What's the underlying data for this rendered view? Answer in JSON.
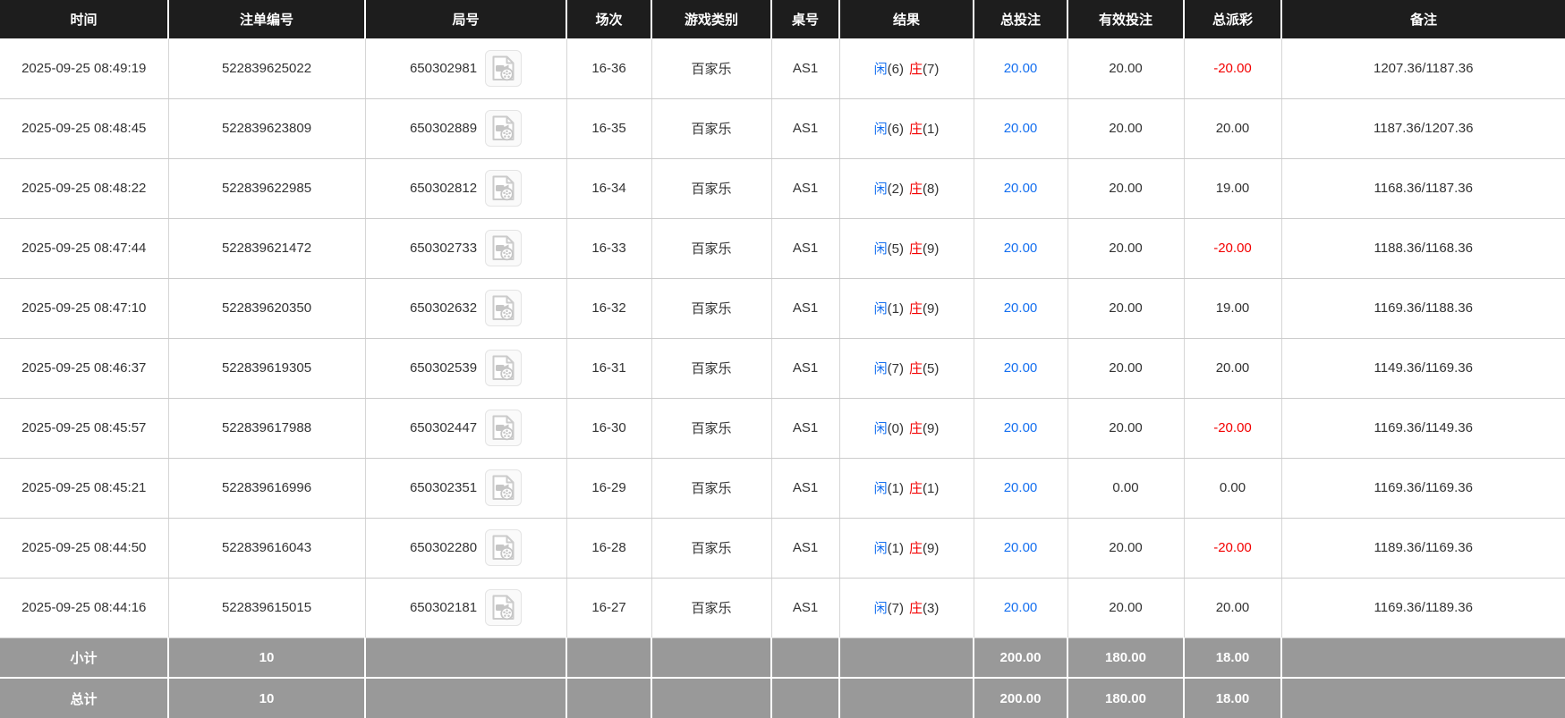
{
  "table": {
    "columns": [
      {
        "label": "时间"
      },
      {
        "label": "注单编号"
      },
      {
        "label": "局号"
      },
      {
        "label": "场次"
      },
      {
        "label": "游戏类别"
      },
      {
        "label": "桌号"
      },
      {
        "label": "结果"
      },
      {
        "label": "总投注"
      },
      {
        "label": "有效投注"
      },
      {
        "label": "总派彩"
      },
      {
        "label": "备注"
      }
    ],
    "rows": [
      {
        "time": "2025-09-25 08:49:19",
        "bet_id": "522839625022",
        "round": "650302981",
        "session": "16-36",
        "game_type": "百家乐",
        "table_no": "AS1",
        "result": {
          "p": "闲",
          "pn": "(6)",
          "b": "庄",
          "bn": "(7)"
        },
        "total_bet": "20.00",
        "valid_bet": "20.00",
        "payout": "-20.00",
        "remark": "1207.36/1187.36"
      },
      {
        "time": "2025-09-25 08:48:45",
        "bet_id": "522839623809",
        "round": "650302889",
        "session": "16-35",
        "game_type": "百家乐",
        "table_no": "AS1",
        "result": {
          "p": "闲",
          "pn": "(6)",
          "b": "庄",
          "bn": "(1)"
        },
        "total_bet": "20.00",
        "valid_bet": "20.00",
        "payout": "20.00",
        "remark": "1187.36/1207.36"
      },
      {
        "time": "2025-09-25 08:48:22",
        "bet_id": "522839622985",
        "round": "650302812",
        "session": "16-34",
        "game_type": "百家乐",
        "table_no": "AS1",
        "result": {
          "p": "闲",
          "pn": "(2)",
          "b": "庄",
          "bn": "(8)"
        },
        "total_bet": "20.00",
        "valid_bet": "20.00",
        "payout": "19.00",
        "remark": "1168.36/1187.36"
      },
      {
        "time": "2025-09-25 08:47:44",
        "bet_id": "522839621472",
        "round": "650302733",
        "session": "16-33",
        "game_type": "百家乐",
        "table_no": "AS1",
        "result": {
          "p": "闲",
          "pn": "(5)",
          "b": "庄",
          "bn": "(9)"
        },
        "total_bet": "20.00",
        "valid_bet": "20.00",
        "payout": "-20.00",
        "remark": "1188.36/1168.36"
      },
      {
        "time": "2025-09-25 08:47:10",
        "bet_id": "522839620350",
        "round": "650302632",
        "session": "16-32",
        "game_type": "百家乐",
        "table_no": "AS1",
        "result": {
          "p": "闲",
          "pn": "(1)",
          "b": "庄",
          "bn": "(9)"
        },
        "total_bet": "20.00",
        "valid_bet": "20.00",
        "payout": "19.00",
        "remark": "1169.36/1188.36"
      },
      {
        "time": "2025-09-25 08:46:37",
        "bet_id": "522839619305",
        "round": "650302539",
        "session": "16-31",
        "game_type": "百家乐",
        "table_no": "AS1",
        "result": {
          "p": "闲",
          "pn": "(7)",
          "b": "庄",
          "bn": "(5)"
        },
        "total_bet": "20.00",
        "valid_bet": "20.00",
        "payout": "20.00",
        "remark": "1149.36/1169.36"
      },
      {
        "time": "2025-09-25 08:45:57",
        "bet_id": "522839617988",
        "round": "650302447",
        "session": "16-30",
        "game_type": "百家乐",
        "table_no": "AS1",
        "result": {
          "p": "闲",
          "pn": "(0)",
          "b": "庄",
          "bn": "(9)"
        },
        "total_bet": "20.00",
        "valid_bet": "20.00",
        "payout": "-20.00",
        "remark": "1169.36/1149.36"
      },
      {
        "time": "2025-09-25 08:45:21",
        "bet_id": "522839616996",
        "round": "650302351",
        "session": "16-29",
        "game_type": "百家乐",
        "table_no": "AS1",
        "result": {
          "p": "闲",
          "pn": "(1)",
          "b": "庄",
          "bn": "(1)"
        },
        "total_bet": "20.00",
        "valid_bet": "0.00",
        "payout": "0.00",
        "remark": "1169.36/1169.36"
      },
      {
        "time": "2025-09-25 08:44:50",
        "bet_id": "522839616043",
        "round": "650302280",
        "session": "16-28",
        "game_type": "百家乐",
        "table_no": "AS1",
        "result": {
          "p": "闲",
          "pn": "(1)",
          "b": "庄",
          "bn": "(9)"
        },
        "total_bet": "20.00",
        "valid_bet": "20.00",
        "payout": "-20.00",
        "remark": "1189.36/1169.36"
      },
      {
        "time": "2025-09-25 08:44:16",
        "bet_id": "522839615015",
        "round": "650302181",
        "session": "16-27",
        "game_type": "百家乐",
        "table_no": "AS1",
        "result": {
          "p": "闲",
          "pn": "(7)",
          "b": "庄",
          "bn": "(3)"
        },
        "total_bet": "20.00",
        "valid_bet": "20.00",
        "payout": "20.00",
        "remark": "1169.36/1189.36"
      }
    ],
    "subtotal": {
      "label": "小计",
      "count": "10",
      "total_bet": "200.00",
      "valid_bet": "180.00",
      "payout": "18.00"
    },
    "grand_total": {
      "label": "总计",
      "count": "10",
      "total_bet": "200.00",
      "valid_bet": "180.00",
      "payout": "18.00"
    },
    "icons": {
      "round_video": "video-file-icon"
    },
    "colors": {
      "header_bg": "#1d1d1d",
      "summary_bg": "#999999",
      "bet_blue": "#1670f0",
      "loss_red": "#f30000",
      "player_blue": "#1670f0",
      "banker_red": "#f30000",
      "row_border": "#cccccc"
    }
  }
}
